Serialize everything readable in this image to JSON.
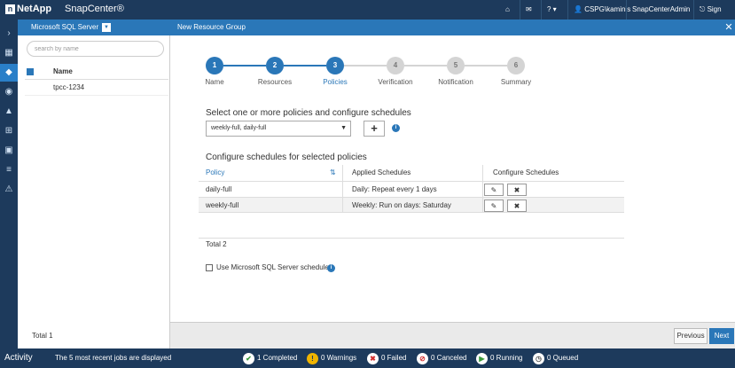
{
  "topbar": {
    "logo": "NetApp",
    "product": "SnapCenter®",
    "user": "CSPG\\kaminis",
    "role": "SnapCenterAdmin",
    "signout": "Sign Out"
  },
  "resource_panel": {
    "header": "Microsoft SQL Server",
    "search_placeholder": "search by name",
    "column_name": "Name",
    "rows": [
      "tpcc-1234"
    ],
    "total": "Total 1"
  },
  "main": {
    "title": "New Resource Group",
    "steps": [
      {
        "num": "1",
        "label": "Name",
        "state": "done"
      },
      {
        "num": "2",
        "label": "Resources",
        "state": "done"
      },
      {
        "num": "3",
        "label": "Policies",
        "state": "current"
      },
      {
        "num": "4",
        "label": "Verification",
        "state": "todo"
      },
      {
        "num": "5",
        "label": "Notification",
        "state": "todo"
      },
      {
        "num": "6",
        "label": "Summary",
        "state": "todo"
      }
    ],
    "select_heading": "Select one or more policies and configure schedules",
    "policy_select_value": "weekly-full, daily-full",
    "schedules_heading": "Configure schedules for selected policies",
    "table": {
      "headers": [
        "Policy",
        "Applied Schedules",
        "Configure Schedules"
      ],
      "rows": [
        {
          "policy": "daily-full",
          "schedule": "Daily: Repeat every 1 days"
        },
        {
          "policy": "weekly-full",
          "schedule": "Weekly: Run on days: Saturday"
        }
      ]
    },
    "total": "Total 2",
    "sql_scheduler_label": "Use Microsoft SQL Server scheduler",
    "previous": "Previous",
    "next": "Next"
  },
  "activity": {
    "title": "Activity",
    "message": "The 5 most recent jobs are displayed",
    "completed": "1 Completed",
    "warnings": "0 Warnings",
    "failed": "0 Failed",
    "canceled": "0 Canceled",
    "running": "0 Running",
    "queued": "0 Queued"
  },
  "colors": {
    "brand_dark": "#1d3a5c",
    "accent": "#2a77b8"
  }
}
